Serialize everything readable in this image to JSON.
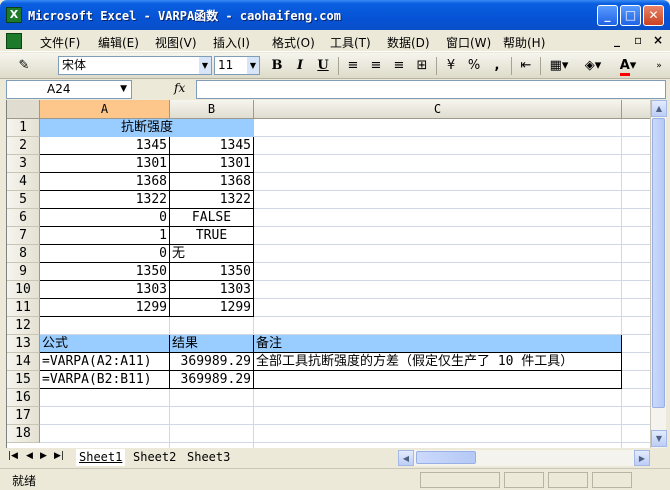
{
  "window": {
    "title": "Microsoft Excel - VARPA函数 - caohaifeng.com",
    "app_icon_glyph": "X",
    "minimize_glyph": "_",
    "maximize_glyph": "□",
    "close_glyph": "✕"
  },
  "menubar": {
    "items": [
      "文件(F)",
      "编辑(E)",
      "视图(V)",
      "插入(I)",
      "格式(O)",
      "工具(T)",
      "数据(D)",
      "窗口(W)",
      "帮助(H)"
    ],
    "right": [
      "_",
      "▫",
      "×"
    ]
  },
  "toolbar": {
    "font_name": "宋体",
    "font_size": "11",
    "bold": "B",
    "italic": "I",
    "underline": "U",
    "percent": "%",
    "comma": ",",
    "font_color_glyph": "A",
    "font_color": "#ff0000"
  },
  "formula_bar": {
    "name_box": "A24",
    "fx": "fx",
    "formula": ""
  },
  "columns": [
    "A",
    "B",
    "C"
  ],
  "rows": [
    "1",
    "2",
    "3",
    "4",
    "5",
    "6",
    "7",
    "8",
    "9",
    "10",
    "11",
    "12",
    "13",
    "14",
    "15",
    "16",
    "17",
    "18"
  ],
  "cells": {
    "A1": "抗断强度",
    "A2": "1345",
    "B2": "1345",
    "A3": "1301",
    "B3": "1301",
    "A4": "1368",
    "B4": "1368",
    "A5": "1322",
    "B5": "1322",
    "A6": "0",
    "B6": "FALSE",
    "A7": "1",
    "B7": "TRUE",
    "A8": "0",
    "B8": "无",
    "A9": "1350",
    "B9": "1350",
    "A10": "1303",
    "B10": "1303",
    "A11": "1299",
    "B11": "1299",
    "A13": "公式",
    "B13": "结果",
    "C13": "备注",
    "A14": "=VARPA(A2:A11)",
    "B14": "369989.29",
    "C14": "全部工具抗断强度的方差（假定仅生产了 10 件工具）",
    "A15": "=VARPA(B2:B11)",
    "B15": "369989.29"
  },
  "sheet_tabs": [
    "Sheet1",
    "Sheet2",
    "Sheet3"
  ],
  "tab_nav": [
    "|◀",
    "◀",
    "▶",
    "▶|"
  ],
  "status": "就绪",
  "colors": {
    "header_fill": "#99ccff",
    "title_bar": "#0653d6",
    "selected_header": "#fdc78b"
  }
}
